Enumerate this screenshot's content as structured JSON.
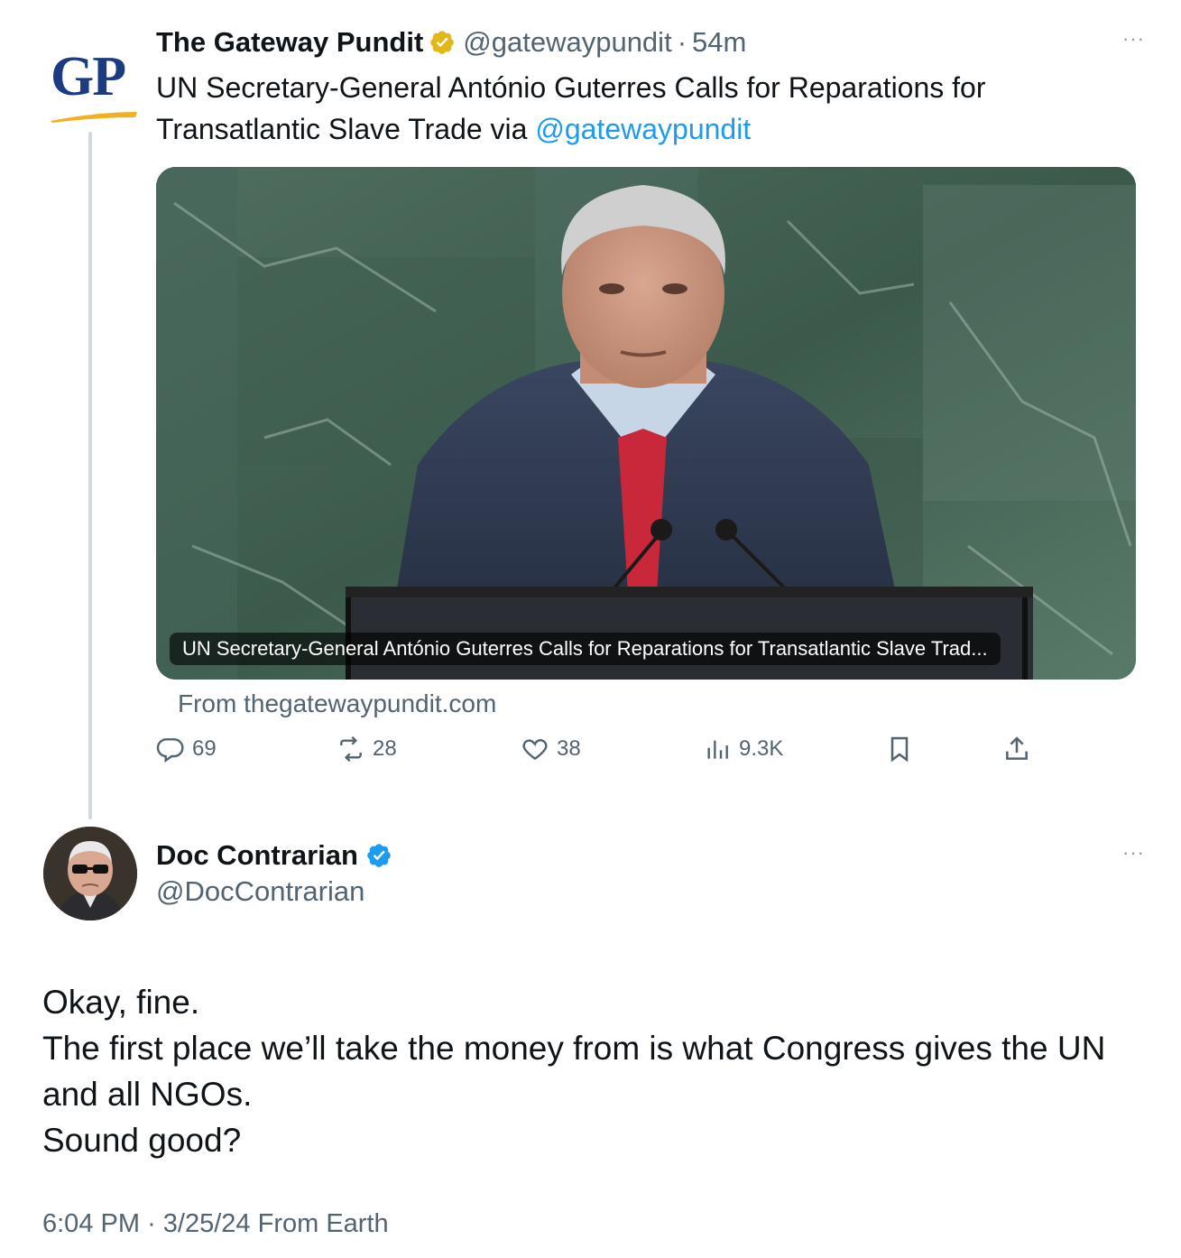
{
  "parent_tweet": {
    "logo_text": "GP",
    "author_name": "The Gateway Pundit",
    "handle": "@gatewaypundit",
    "separator": "·",
    "time_ago": "54m",
    "text_before_mention": "UN Secretary-General António Guterres Calls for Reparations for Transatlantic Slave Trade via ",
    "mention": "@gatewaypundit",
    "card": {
      "caption": "UN Secretary-General António Guterres Calls for Reparations for Transatlantic Slave Trad...",
      "source": "From thegatewaypundit.com"
    },
    "actions": {
      "replies": "69",
      "reposts": "28",
      "likes": "38",
      "views": "9.3K"
    },
    "more_glyph": "···"
  },
  "main_tweet": {
    "author_name": "Doc Contrarian",
    "handle": "@DocContrarian",
    "text_lines": [
      "Okay, fine.",
      "The first place we’ll take the money from is what Congress gives the UN",
      "and all NGOs.",
      "Sound good?"
    ],
    "time": "6:04 PM",
    "separator": "·",
    "date_source": "3/25/24 From Earth",
    "more_glyph": "···"
  },
  "colors": {
    "text": "#0f1419",
    "secondary": "#536471",
    "link": "#1d9bf0",
    "verified_blue": "#1d9bf0",
    "verified_gold": "#e2b719",
    "gp_blue": "#1d3b80",
    "gp_gold": "#f2b01e",
    "thread_line": "#cfd9de"
  },
  "icons": [
    "reply-icon",
    "repost-icon",
    "like-icon",
    "views-icon",
    "bookmark-icon",
    "share-icon",
    "verified-gold-icon",
    "verified-blue-icon",
    "more-icon"
  ]
}
